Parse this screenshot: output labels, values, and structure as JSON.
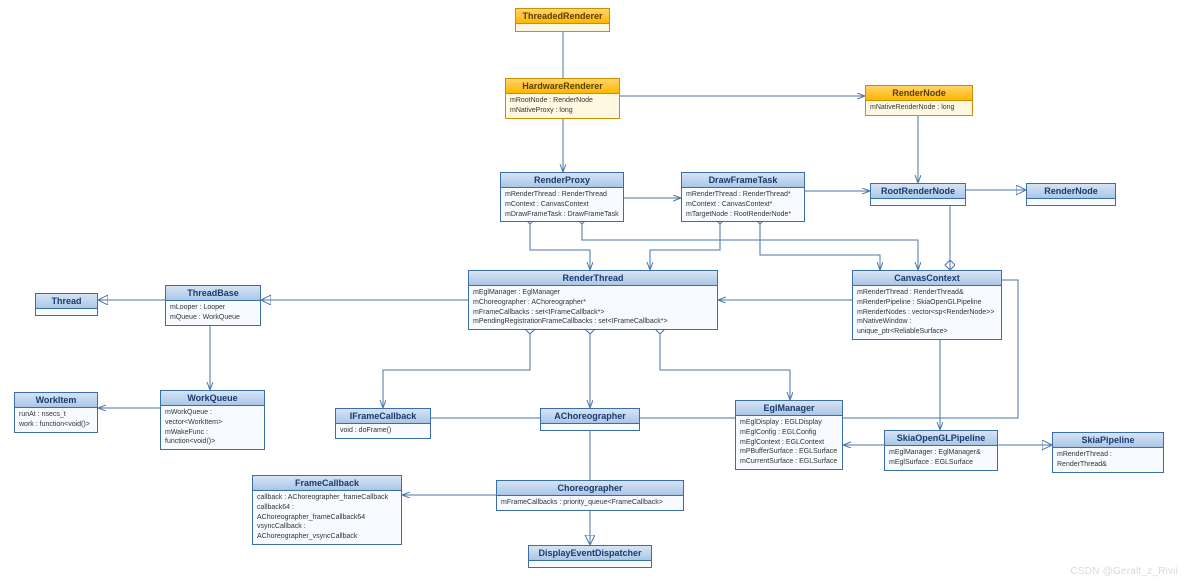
{
  "watermark": "CSDN @Geralt_z_Rivii",
  "classes": {
    "ThreadedRenderer": {
      "name": "ThreadedRenderer",
      "attrs": []
    },
    "HardwareRenderer": {
      "name": "HardwareRenderer",
      "attrs": [
        "mRootNode : RenderNode",
        "mNativeProxy : long"
      ]
    },
    "RenderNode1": {
      "name": "RenderNode",
      "attrs": [
        "mNativeRenderNode : long"
      ]
    },
    "RenderProxy": {
      "name": "RenderProxy",
      "attrs": [
        "mRenderThread : RenderThread",
        "mContext : CanvasContext",
        "mDrawFrameTask : DrawFrameTask"
      ]
    },
    "DrawFrameTask": {
      "name": "DrawFrameTask",
      "attrs": [
        "mRenderThread : RenderThread*",
        "mContext : CanvasContext*",
        "mTargetNode : RootRenderNode*"
      ]
    },
    "RootRenderNode": {
      "name": "RootRenderNode",
      "attrs": []
    },
    "RenderNode2": {
      "name": "RenderNode",
      "attrs": []
    },
    "RenderThread": {
      "name": "RenderThread",
      "attrs": [
        "mEglManager : EglManager",
        "mChoreographer : AChoreographer*",
        "mFrameCallbacks : set<IFrameCallback*>",
        "mPendingRegistrationFrameCallbacks : set<IFrameCallback*>"
      ]
    },
    "CanvasContext": {
      "name": "CanvasContext",
      "attrs": [
        "mRenderThread : RenderThread&",
        "mRenderPipeline : SkiaOpenGLPipeline",
        "mRenderNodes : vector<sp<RenderNode>>",
        "mNativeWindow : unique_ptr<ReliableSurface>"
      ]
    },
    "ThreadBase": {
      "name": "ThreadBase",
      "attrs": [
        "mLooper : Looper",
        "mQueue : WorkQueue"
      ]
    },
    "Thread": {
      "name": "Thread",
      "attrs": []
    },
    "WorkQueue": {
      "name": "WorkQueue",
      "attrs": [
        "mWorkQueue : vector<WorkItem>",
        "mWakeFunc : function<void()>"
      ]
    },
    "WorkItem": {
      "name": "WorkItem",
      "attrs": [
        "runAt : nsecs_t",
        "work : function<void()>"
      ]
    },
    "IFrameCallback": {
      "name": "IFrameCallback",
      "attrs": [
        "void : doFrame()"
      ]
    },
    "AChoreographer": {
      "name": "AChoreographer",
      "attrs": []
    },
    "EglManager": {
      "name": "EglManager",
      "attrs": [
        "mEglDisplay : EGLDisplay",
        "mEglConfig : EGLConfig",
        "mEglContext : EGLContext",
        "mPBufferSurface : EGLSurface",
        "mCurrentSurface : EGLSurface"
      ]
    },
    "SkiaOpenGLPipeline": {
      "name": "SkiaOpenGLPipeline",
      "attrs": [
        "mEglManager : EglManager&",
        "mEglSurface : EGLSurface"
      ]
    },
    "SkiaPipeline": {
      "name": "SkiaPipeline",
      "attrs": [
        "mRenderThread : RenderThread&"
      ]
    },
    "FrameCallback": {
      "name": "FrameCallback",
      "attrs": [
        "callback : AChoreographer_frameCallback",
        "callback64 : AChoreographer_frameCallback64",
        "vsyncCallback : AChoreographer_vsyncCallback"
      ]
    },
    "Choreographer": {
      "name": "Choreographer",
      "attrs": [
        "mFrameCallbacks : priority_queue<FrameCallback>"
      ]
    },
    "DisplayEventDispatcher": {
      "name": "DisplayEventDispatcher",
      "attrs": []
    }
  }
}
